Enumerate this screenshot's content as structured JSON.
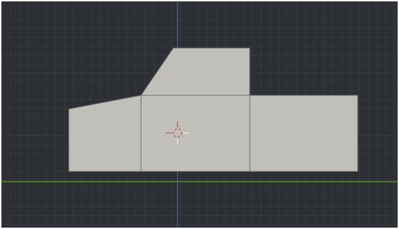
{
  "app": {
    "name": "",
    "view": "3D Viewport"
  },
  "colors": {
    "background": "#2c3034",
    "grid_line": "#3a3e43",
    "axis_x": "#5f8a34",
    "axis_z": "#3f6c96",
    "face_fill": "#c0bfba",
    "face_edge": "#6d6c68",
    "cursor_primary": "#b05a45",
    "cursor_secondary": "#e9e9e6"
  },
  "icons": {
    "cursor": "3d-cursor-icon"
  },
  "mesh": {
    "name": "",
    "faces": 4,
    "mode": "object"
  }
}
